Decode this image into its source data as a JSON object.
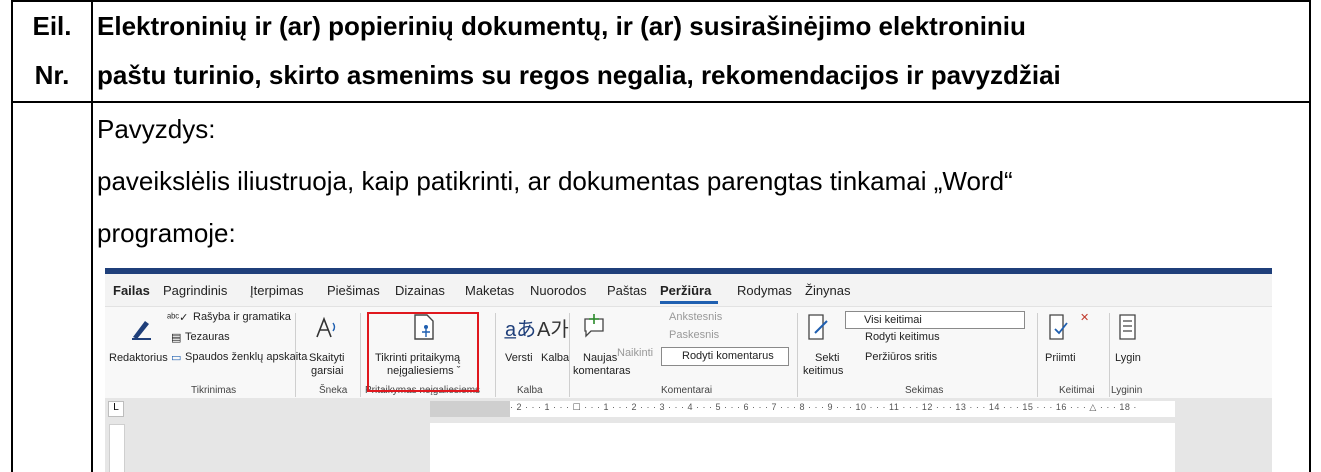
{
  "header": {
    "num_line1": "Eil.",
    "num_line2": "Nr.",
    "title_line1": "Elektroninių ir (ar) popierinių dokumentų, ir (ar) susirašinėjimo elektroniniu",
    "title_line2": "paštu turinio, skirto asmenims su regos negalia, rekomendacijos ir pavyzdžiai"
  },
  "body": {
    "line1": "Pavyzdys:",
    "line2": "paveikslėlis iliustruoja, kaip patikrinti, ar dokumentas parengtas tinkamai „Word“",
    "line3": "programoje:"
  },
  "ribbon": {
    "tabs": [
      "Failas",
      "Pagrindinis",
      "Įterpimas",
      "Piešimas",
      "Dizainas",
      "Maketas",
      "Nuorodos",
      "Paštas",
      "Peržiūra",
      "Rodymas",
      "Žinynas"
    ],
    "active_tab": "Peržiūra",
    "redaktorius": "Redaktorius",
    "rasyba": "Rašyba ir gramatika",
    "tezauras": "Tezauras",
    "spaudos": "Spaudos ženklų apskaita",
    "group_tikrinimas": "Tikrinimas",
    "skaityti_1": "Skaityti",
    "skaityti_2": "garsiai",
    "group_sneka": "Šneka",
    "tikrinti_1": "Tikrinti pritaikymą",
    "tikrinti_2": "neįgaliesiems ˇ",
    "group_pritaikymas": "Pritaikymas neįgaliesiems",
    "versti": "Versti",
    "kalba": "Kalba",
    "group_kalba": "Kalba",
    "naujas_1": "Naujas",
    "naujas_2": "komentaras",
    "naikinti": "Naikinti",
    "ankstesnis": "Ankstesnis",
    "paskesnis": "Paskesnis",
    "rodyti_komentarus": "Rodyti komentarus",
    "group_komentarai": "Komentarai",
    "sekti_1": "Sekti",
    "sekti_2": "keitimus",
    "visi_keitimai": "Visi keitimai",
    "rodyti_keitimus": "Rodyti keitimus",
    "perziuros_sritis": "Peržiūros sritis",
    "group_sekimas": "Sekimas",
    "priimti": "Priimti",
    "group_keitimai": "Keitimai",
    "lygin": "Lygin",
    "group_lyginimas": "Lyginin",
    "ruler_text": "· 2 · · · 1 · · · ☐ · · · 1 · · · 2 · · · 3 · · · 4 · · · 5 · · · 6 · · · 7 · · · 8 · · · 9 · · · 10 · · · 11 · · · 12 · · · 13 · · · 14 · · · 15 · · · 16 · · · △ · · · 18 ·"
  },
  "colors": {
    "highlight": "#e0181e",
    "title_bar": "#1f3f7a",
    "active_underline": "#1f5fb0"
  }
}
